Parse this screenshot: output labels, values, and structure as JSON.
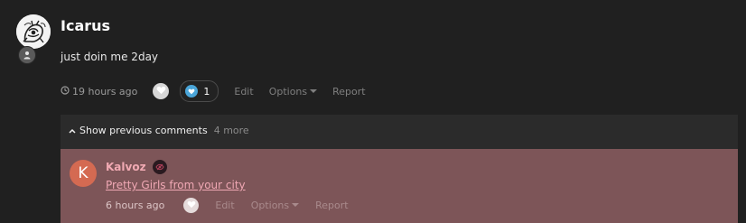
{
  "post": {
    "author": "Icarus",
    "body": "just doin me 2day",
    "time": "19 hours ago",
    "reaction_count": "1",
    "actions": {
      "edit": "Edit",
      "options": "Options",
      "report": "Report"
    }
  },
  "comments": {
    "show_previous_label": "Show previous comments",
    "more_count": "4 more",
    "items": [
      {
        "avatar_letter": "K",
        "author": "Kalvoz",
        "text": "Pretty Girls from your city",
        "time": "6 hours ago",
        "actions": {
          "edit": "Edit",
          "options": "Options",
          "report": "Report"
        }
      }
    ]
  },
  "colors": {
    "background": "#202020",
    "comment_highlight": "#7d5558",
    "comment_author": "#f1aab3",
    "reaction_accent": "#4aa5d8",
    "avatar_letter_bg": "#d46a52"
  },
  "icons": {
    "clock": "clock-icon",
    "heart": "heart-icon",
    "user": "user-icon",
    "chevron": "chevron-up-icon",
    "caret": "caret-down-icon"
  }
}
